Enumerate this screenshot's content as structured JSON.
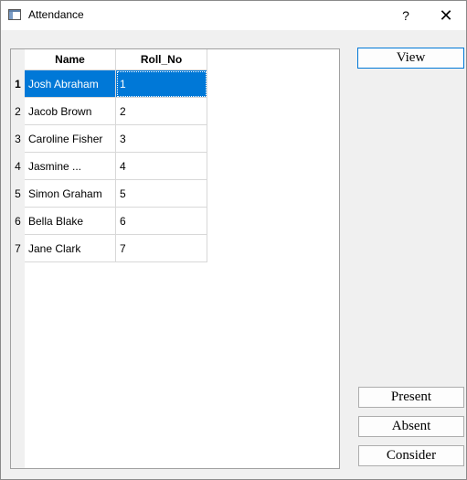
{
  "window": {
    "title": "Attendance",
    "help_label": "?",
    "close_label": "✕"
  },
  "table": {
    "columns": [
      "Name",
      "Roll_No"
    ],
    "selected_row": 0,
    "rows": [
      {
        "num": "1",
        "name": "Josh Abraham",
        "roll": "1"
      },
      {
        "num": "2",
        "name": "Jacob Brown",
        "roll": "2"
      },
      {
        "num": "3",
        "name": "Caroline Fisher",
        "roll": "3"
      },
      {
        "num": "4",
        "name": "Jasmine ...",
        "roll": "4"
      },
      {
        "num": "5",
        "name": "Simon Graham",
        "roll": "5"
      },
      {
        "num": "6",
        "name": "Bella Blake",
        "roll": "6"
      },
      {
        "num": "7",
        "name": "Jane Clark",
        "roll": "7"
      }
    ]
  },
  "buttons": {
    "view": "View",
    "present": "Present",
    "absent": "Absent",
    "consider": "Consider"
  },
  "colors": {
    "selection": "#0078d7",
    "window_bg": "#f0f0f0"
  }
}
